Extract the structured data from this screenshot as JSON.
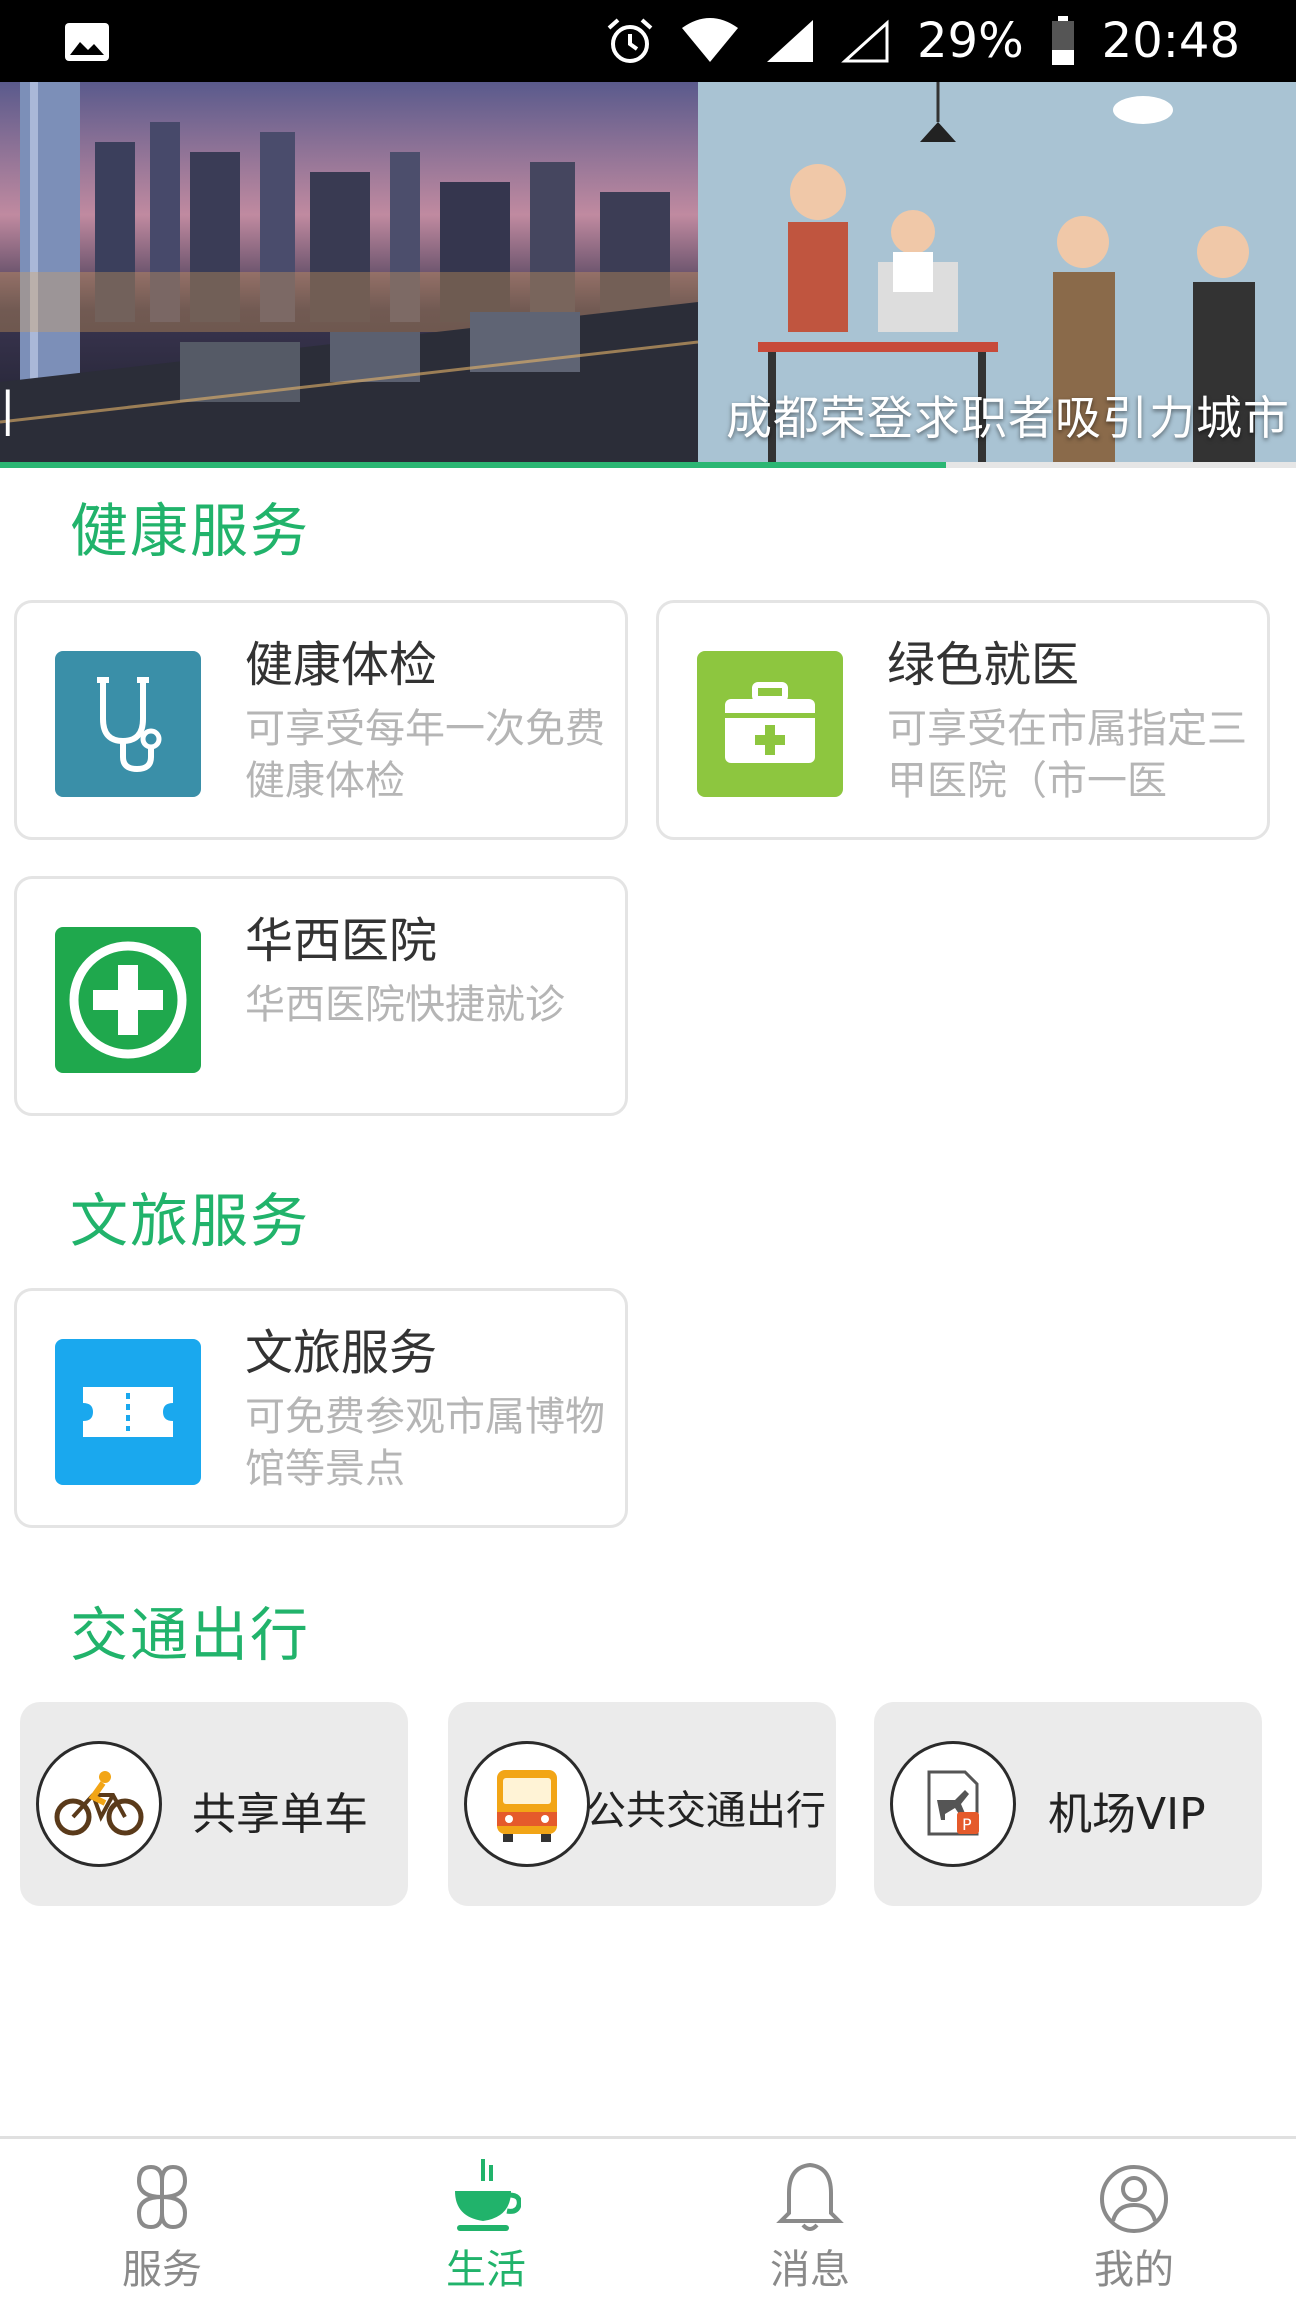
{
  "status_bar": {
    "battery": "29%",
    "time": "20:48",
    "icons": [
      "gallery-icon",
      "alarm-icon",
      "wifi-icon",
      "signal-icon",
      "signal-empty-icon",
      "battery-icon"
    ]
  },
  "banner": {
    "caption": "成都荣登求职者吸引力城市",
    "progress": 0.73,
    "accent_color": "#2bb673"
  },
  "sections": {
    "health": {
      "title": "健康服务",
      "cards": [
        {
          "title": "健康体检",
          "desc": "可享受每年一次免费健康体检",
          "icon": "stethoscope-icon",
          "color": "#3a8fa8"
        },
        {
          "title": "绿色就医",
          "desc": "可享受在市属指定三甲医院（市一医",
          "icon": "medical-kit-icon",
          "color": "#8dc63f"
        },
        {
          "title": "华西医院",
          "desc": "华西医院快捷就诊",
          "icon": "medical-cross-icon",
          "color": "#1fa84d"
        }
      ]
    },
    "culture": {
      "title": "文旅服务",
      "cards": [
        {
          "title": "文旅服务",
          "desc": "可免费参观市属博物馆等景点",
          "icon": "ticket-icon",
          "color": "#1aa8ee"
        }
      ]
    },
    "transport": {
      "title": "交通出行",
      "tiles": [
        {
          "label": "共享单车",
          "icon": "bicycle-icon"
        },
        {
          "label": "公共交通出行",
          "icon": "bus-icon"
        },
        {
          "label": "机场VIP",
          "icon": "airport-parking-icon"
        }
      ]
    }
  },
  "bottom_nav": {
    "items": [
      {
        "label": "服务",
        "icon": "services-grid-icon"
      },
      {
        "label": "生活",
        "icon": "coffee-cup-icon",
        "active": true
      },
      {
        "label": "消息",
        "icon": "bell-icon"
      },
      {
        "label": "我的",
        "icon": "profile-icon"
      }
    ]
  },
  "colors": {
    "accent": "#21b36b",
    "inactive": "#8a8a8a"
  }
}
